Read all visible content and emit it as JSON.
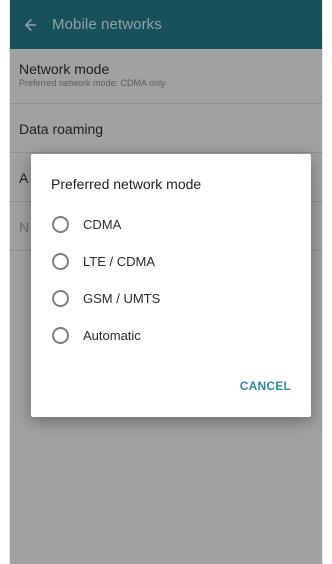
{
  "app_bar": {
    "back_icon": "arrow-left-icon",
    "title": "Mobile networks",
    "background_color": "#237b8b"
  },
  "settings": {
    "network_mode": {
      "title": "Network mode",
      "subtitle": "Preferred network mode: CDMA only"
    },
    "data_roaming": {
      "title": "Data roaming"
    },
    "access_points": {
      "title": "A"
    },
    "network_operators": {
      "title": "N"
    }
  },
  "dialog": {
    "title": "Preferred network mode",
    "options": [
      {
        "label": "CDMA"
      },
      {
        "label": "LTE / CDMA"
      },
      {
        "label": "GSM / UMTS"
      },
      {
        "label": "Automatic"
      }
    ],
    "cancel_label": "CANCEL",
    "accent_color": "#2f8aa3"
  }
}
